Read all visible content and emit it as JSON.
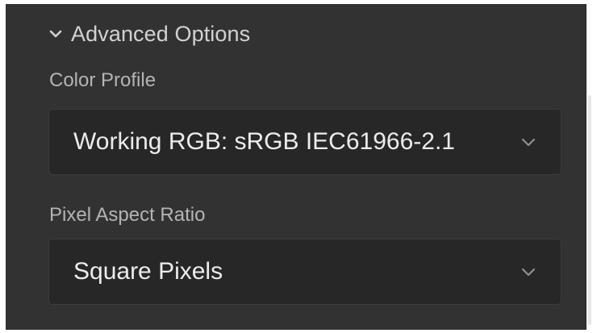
{
  "section": {
    "title": "Advanced Options",
    "expanded_icon": "chevron-down-icon"
  },
  "color_profile": {
    "label": "Color Profile",
    "value": "Working RGB: sRGB IEC61966-2.1",
    "icon": "chevron-down-icon"
  },
  "pixel_aspect_ratio": {
    "label": "Pixel Aspect Ratio",
    "value": "Square Pixels",
    "icon": "chevron-down-icon"
  },
  "colors": {
    "panel_bg": "#323232",
    "field_bg": "#272727",
    "label_text": "#b4b4b4",
    "value_text": "#ececec"
  }
}
